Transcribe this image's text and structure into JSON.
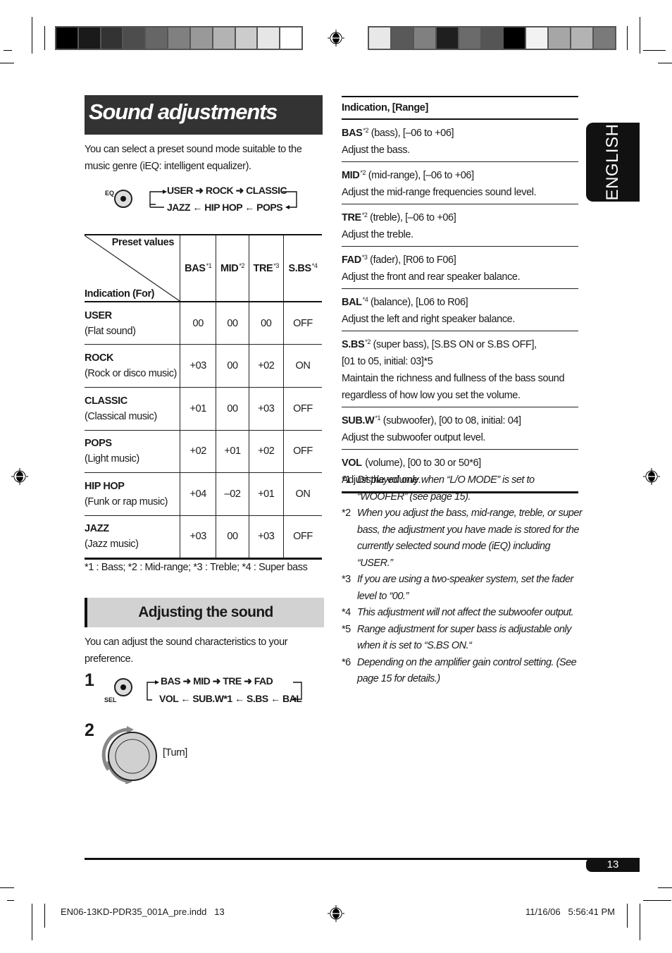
{
  "print_marks": {
    "left_swatches": [
      "#000000",
      "#1a1a1a",
      "#333333",
      "#4d4d4d",
      "#666666",
      "#808080",
      "#999999",
      "#b3b3b3",
      "#cccccc",
      "#e6e6e6",
      "#ffffff"
    ],
    "right_swatches": [
      "#e8e8e8",
      "#595959",
      "#808080",
      "#1f1f1f",
      "#6b6b6b",
      "#555555",
      "#000000",
      "#f2f2f2",
      "#a6a6a6",
      "#b3b3b3",
      "#7a7a7a"
    ]
  },
  "title": "Sound adjustments",
  "intro": "You can select a preset sound mode suitable to the music genre (iEQ: intelligent equalizer).",
  "eq_flow": {
    "button_label": "EQ",
    "row1": [
      "USER",
      "ROCK",
      "CLASSIC"
    ],
    "row2": [
      "JAZZ",
      "HIP HOP",
      "POPS"
    ]
  },
  "preset_table": {
    "corner_top": "Preset values",
    "corner_bottom": "Indication (For)",
    "columns": [
      {
        "label": "BAS",
        "note": "*1"
      },
      {
        "label": "MID",
        "note": "*2"
      },
      {
        "label": "TRE",
        "note": "*3"
      },
      {
        "label": "S.BS",
        "note": "*4"
      }
    ],
    "rows": [
      {
        "mode": "USER",
        "desc": "(Flat sound)",
        "values": [
          "00",
          "00",
          "00",
          "OFF"
        ]
      },
      {
        "mode": "ROCK",
        "desc": "(Rock or disco music)",
        "values": [
          "+03",
          "00",
          "+02",
          "ON"
        ]
      },
      {
        "mode": "CLASSIC",
        "desc": "(Classical music)",
        "values": [
          "+01",
          "00",
          "+03",
          "OFF"
        ]
      },
      {
        "mode": "POPS",
        "desc": "(Light music)",
        "values": [
          "+02",
          "+01",
          "+02",
          "OFF"
        ]
      },
      {
        "mode": "HIP HOP",
        "desc": "(Funk or rap music)",
        "values": [
          "+04",
          "–02",
          "+01",
          "ON"
        ]
      },
      {
        "mode": "JAZZ",
        "desc": "(Jazz music)",
        "values": [
          "+03",
          "00",
          "+03",
          "OFF"
        ]
      }
    ],
    "note": "*1 : Bass; *2 : Mid-range; *3 : Treble; *4 : Super bass"
  },
  "adjusting": {
    "heading": "Adjusting the sound",
    "intro": "You can adjust the sound characteristics to your preference.",
    "step1": {
      "number": "1",
      "button_label": "SEL",
      "row1": [
        "BAS",
        "MID",
        "TRE",
        "FAD"
      ],
      "row2": [
        "VOL",
        "SUB.W*1",
        "S.BS",
        "BAL"
      ]
    },
    "step2": {
      "number": "2",
      "action": "[Turn]"
    }
  },
  "indications": {
    "header": "Indication, [Range]",
    "items": [
      {
        "name": "BAS",
        "note": "*2",
        "range": " (bass), [–06 to +06]",
        "desc": "Adjust the bass."
      },
      {
        "name": "MID",
        "note": "*2",
        "range": " (mid-range), [–06 to +06]",
        "desc": "Adjust the mid-range frequencies sound level."
      },
      {
        "name": "TRE",
        "note": "*2",
        "range": " (treble), [–06 to +06]",
        "desc": "Adjust the treble."
      },
      {
        "name": "FAD",
        "note": "*3",
        "range": " (fader), [R06 to F06]",
        "desc": "Adjust the front and rear speaker balance."
      },
      {
        "name": "BAL",
        "note": "*4",
        "range": " (balance), [L06 to R06]",
        "desc": "Adjust the left and right speaker balance."
      },
      {
        "name": "S.BS",
        "note": "*2",
        "range": " (super bass), [S.BS ON or S.BS OFF],",
        "range2": "[01 to 05, initial: 03]*5",
        "desc": "Maintain the richness and fullness of the bass sound regardless of how low you set the volume."
      },
      {
        "name": "SUB.W",
        "note": "*1",
        "range": " (subwoofer), [00 to 08, initial: 04]",
        "desc": "Adjust the subwoofer output level."
      },
      {
        "name": "VOL",
        "note": "",
        "range": " (volume), [00 to 30 or 50*6]",
        "desc": "Adjust the volume."
      }
    ]
  },
  "footnotes": [
    {
      "mark": "*1",
      "text": "Displayed only when “L/O MODE” is set to “WOOFER” (see page 15)."
    },
    {
      "mark": "*2",
      "text": "When you adjust the bass, mid-range, treble, or super bass, the adjustment you have made is stored for the currently selected sound mode (iEQ) including “USER.”"
    },
    {
      "mark": "*3",
      "text": "If you are using a two-speaker system, set the fader level to “00.”"
    },
    {
      "mark": "*4",
      "text": "This adjustment will not affect the subwoofer output."
    },
    {
      "mark": "*5",
      "text": "Range adjustment for super bass is adjustable only when it is set to “S.BS ON.“"
    },
    {
      "mark": "*6",
      "text": "Depending on the amplifier gain control setting. (See page 15 for details.)"
    }
  ],
  "language_tab": "ENGLISH",
  "page_number": "13",
  "slug": {
    "file": "EN06-13KD-PDR35_001A_pre.indd   13",
    "timestamp": "11/16/06   5:56:41 PM"
  }
}
